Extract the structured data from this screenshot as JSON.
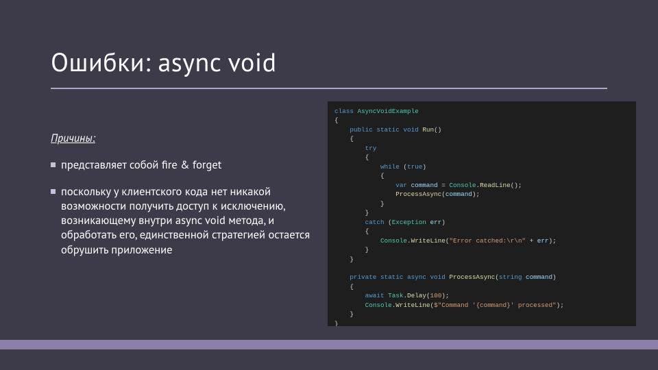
{
  "title": "Ошибки: async void",
  "reasons_label": "Причины:",
  "bullets": [
    "представляет собой fire & forget",
    "поскольку у клиентского кода нет никакой возможности получить доступ к исключению, возникающему внутри async void метода, и обработать его, единственной стратегией остается обрушить приложение"
  ],
  "code": {
    "l01a": "class",
    "l01b": " AsyncVoidExample",
    "l02": "{",
    "l03a": "    public static void",
    "l03b": " Run",
    "l03c": "()",
    "l04": "    {",
    "l05a": "        try",
    "l06": "        {",
    "l07a": "            while",
    "l07b": " (",
    "l07c": "true",
    "l07d": ")",
    "l08": "            {",
    "l09a": "                var",
    "l09b": " command",
    "l09c": " = ",
    "l09d": "Console",
    "l09e": ".",
    "l09f": "ReadLine",
    "l09g": "();",
    "l10a": "                ProcessAsync",
    "l10b": "(",
    "l10c": "command",
    "l10d": ");",
    "l11": "            }",
    "l12": "        }",
    "l13a": "        catch",
    "l13b": " (",
    "l13c": "Exception",
    "l13d": " err",
    "l13e": ")",
    "l14": "        {",
    "l15a": "            Console",
    "l15b": ".",
    "l15c": "WriteLine",
    "l15d": "(",
    "l15e": "\"Error catched:\\r\\n\"",
    "l15f": " + ",
    "l15g": "err",
    "l15h": ");",
    "l16": "        }",
    "l17": "    }",
    "l18": "",
    "l19a": "    private static async void",
    "l19b": " ProcessAsync",
    "l19c": "(",
    "l19d": "string",
    "l19e": " command",
    "l19f": ")",
    "l20": "    {",
    "l21a": "        await",
    "l21b": " Task",
    "l21c": ".",
    "l21d": "Delay",
    "l21e": "(",
    "l21f": "100",
    "l21g": ");",
    "l22a": "        Console",
    "l22b": ".",
    "l22c": "WriteLine",
    "l22d": "(",
    "l22e": "$\"Command '{command}' processed\"",
    "l22f": ");",
    "l23": "    }",
    "l24": "}"
  },
  "colors": {
    "background": "#3d3a4a",
    "accent_bar": "#8b7fa8",
    "underline": "#b2a9c9"
  }
}
